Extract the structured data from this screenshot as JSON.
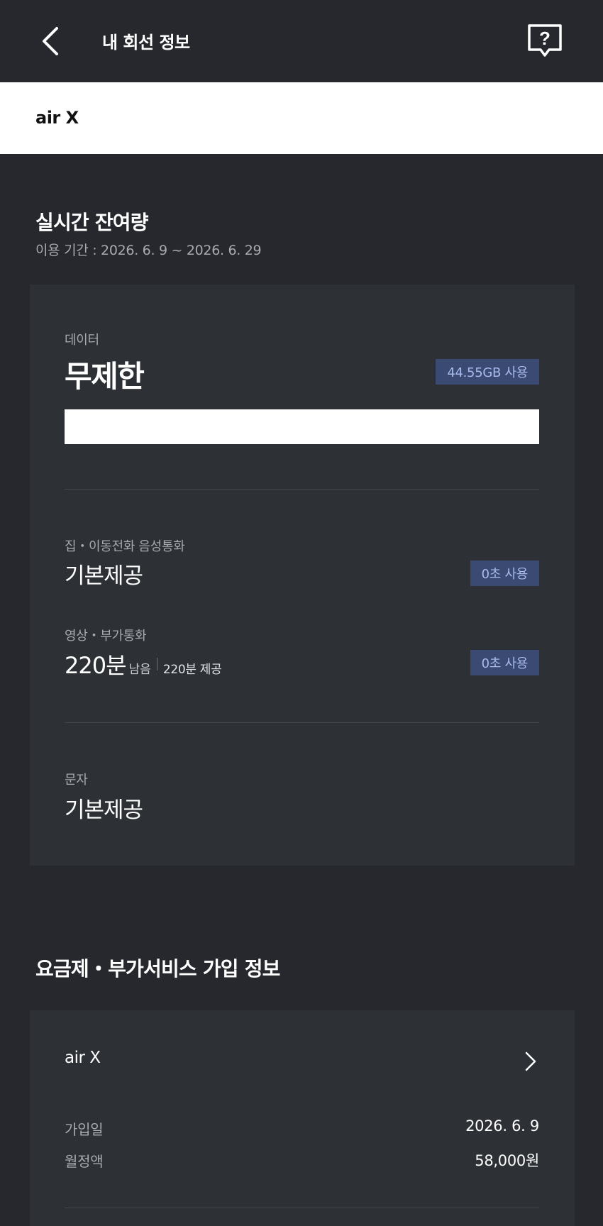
{
  "header": {
    "title": "내 회선 정보",
    "back_icon": "chevron-left-icon",
    "help_icon": "question-bubble-icon"
  },
  "plan_bar": {
    "name": "air X"
  },
  "realtime": {
    "title": "실시간 잔여량",
    "period": "이용 기간 : 2026. 6. 9 ~ 2026. 6. 29",
    "data": {
      "label": "데이터",
      "value": "무제한",
      "used": "44.55GB 사용"
    },
    "voice": {
      "label": "집・이동전화 음성통화",
      "value": "기본제공",
      "used": "0초 사용"
    },
    "video": {
      "label": "영상・부가통화",
      "remaining": "220분",
      "remaining_suffix": "남음",
      "provided": "220분 제공",
      "used": "0초 사용"
    },
    "sms": {
      "label": "문자",
      "value": "기본제공"
    }
  },
  "subscription": {
    "title": "요금제・부가서비스 가입 정보",
    "plan_name": "air X",
    "join_date_label": "가입일",
    "join_date": "2026. 6. 9",
    "monthly_fee_label": "월정액",
    "monthly_fee": "58,000원"
  },
  "colors": {
    "background": "#26282d",
    "card": "#2d3035",
    "badge_bg": "#3a4a73",
    "badge_text": "#a9bbec"
  }
}
